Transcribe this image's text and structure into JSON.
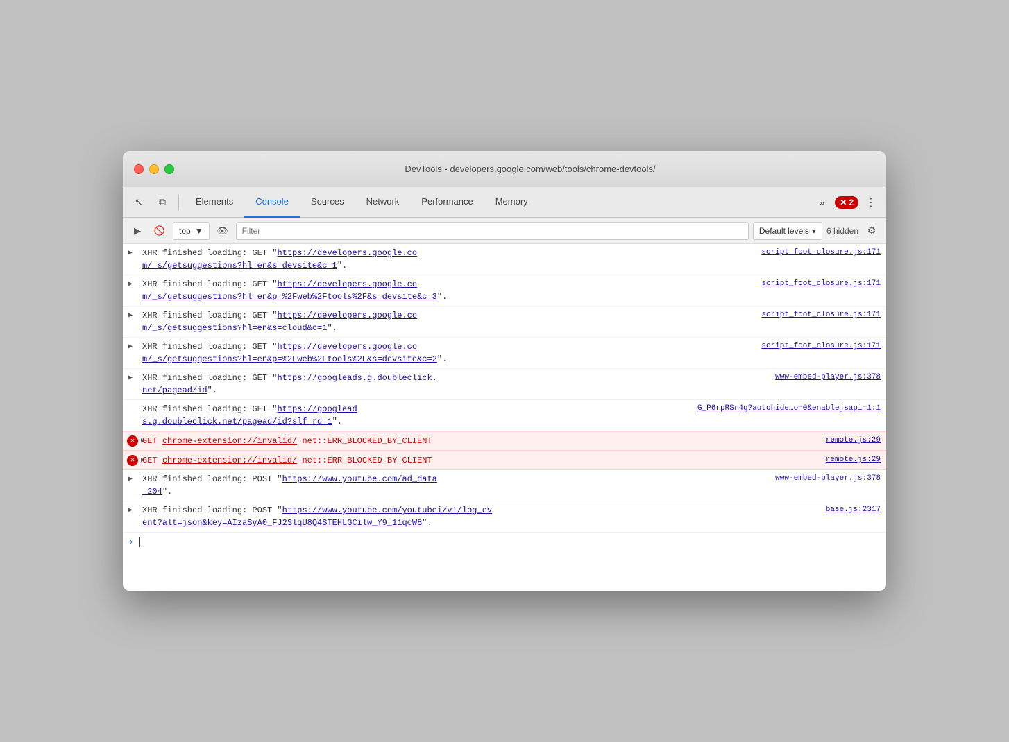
{
  "window": {
    "title": "DevTools - developers.google.com/web/tools/chrome-devtools/",
    "trafficLights": {
      "close": "close",
      "minimize": "minimize",
      "maximize": "maximize"
    }
  },
  "toolbar": {
    "inspectLabel": "↖",
    "deviceLabel": "⧉",
    "tabs": [
      {
        "id": "elements",
        "label": "Elements",
        "active": false
      },
      {
        "id": "console",
        "label": "Console",
        "active": true
      },
      {
        "id": "sources",
        "label": "Sources",
        "active": false
      },
      {
        "id": "network",
        "label": "Network",
        "active": false
      },
      {
        "id": "performance",
        "label": "Performance",
        "active": false
      },
      {
        "id": "memory",
        "label": "Memory",
        "active": false
      }
    ],
    "moreLabel": "»",
    "errorCount": "2",
    "menuLabel": "⋮"
  },
  "consoleToolbar": {
    "runLabel": "▶",
    "clearLabel": "🚫",
    "contextValue": "top",
    "contextArrow": "▼",
    "eyeLabel": "👁",
    "filterPlaceholder": "Filter",
    "levelsLabel": "Default levels",
    "levelsArrow": "▾",
    "hiddenCount": "6 hidden",
    "settingsLabel": "⚙"
  },
  "consoleEntries": [
    {
      "id": 1,
      "type": "xhr",
      "hasArrow": true,
      "content": "XHR finished loading: GET \"https://developers.google.co m/_s/getsuggestions?hl=en&s=devsite&c=1\".",
      "contentLink": "https://developers.google.co m/_s/getsuggestions?hl=en&s=devsite&c=1",
      "source": "script_foot_closure.js:171",
      "isError": false
    },
    {
      "id": 2,
      "type": "xhr",
      "hasArrow": true,
      "content": "XHR finished loading: GET \"https://developers.google.co m/_s/getsuggestions?hl=en&p=%2Fweb%2Ftools%2F&s=devsite&c=3\".",
      "contentLink": "https://developers.google.co m/_s/getsuggestions?hl=en&p=%2Fweb%2Ftools%2F&s=devsite&c=3",
      "source": "script_foot_closure.js:171",
      "isError": false
    },
    {
      "id": 3,
      "type": "xhr",
      "hasArrow": true,
      "content": "XHR finished loading: GET \"https://developers.google.co m/_s/getsuggestions?hl=en&s=cloud&c=1\".",
      "contentLink": "https://developers.google.co m/_s/getsuggestions?hl=en&s=cloud&c=1",
      "source": "script_foot_closure.js:171",
      "isError": false
    },
    {
      "id": 4,
      "type": "xhr",
      "hasArrow": true,
      "content": "XHR finished loading: GET \"https://developers.google.co m/_s/getsuggestions?hl=en&p=%2Fweb%2Ftools%2F&s=devsite&c=2\".",
      "contentLink": "https://developers.google.co m/_s/getsuggestions?hl=en&p=%2Fweb%2Ftools%2F&s=devsite&c=2",
      "source": "script_foot_closure.js:171",
      "isError": false
    },
    {
      "id": 5,
      "type": "xhr",
      "hasArrow": true,
      "content": "XHR finished loading: GET \"https://googleads.g.doubleclick. net/pagead/id\".",
      "contentLink": "https://googleads.g.doubleclick. net/pagead/id",
      "source": "www-embed-player.js:378",
      "isError": false
    },
    {
      "id": 6,
      "type": "xhr",
      "hasArrow": false,
      "content": "XHR finished loading: GET \"https://googlead s.g.doubleclick.net/pagead/id?slf_rd=1\".",
      "contentLink": "https://googlead s.g.doubleclick.net/pagead/id?slf_rd=1",
      "source": "G_P6rpRSr4g?autohide…o=0&enablejsapi=1:1",
      "isError": false
    },
    {
      "id": 7,
      "type": "get-error",
      "hasArrow": true,
      "content": "GET chrome-extension://invalid/",
      "errorText": "net::ERR_BLOCKED_BY_CLIENT",
      "contentLink": "chrome-extension://invalid/",
      "source": "remote.js:29",
      "isError": true
    },
    {
      "id": 8,
      "type": "get-error",
      "hasArrow": true,
      "content": "GET chrome-extension://invalid/",
      "errorText": "net::ERR_BLOCKED_BY_CLIENT",
      "contentLink": "chrome-extension://invalid/",
      "source": "remote.js:29",
      "isError": true
    },
    {
      "id": 9,
      "type": "xhr",
      "hasArrow": true,
      "content": "XHR finished loading: POST \"https://www.youtube.com/ad_data _204\".",
      "contentLink": "https://www.youtube.com/ad_data _204",
      "source": "www-embed-player.js:378",
      "isError": false
    },
    {
      "id": 10,
      "type": "xhr",
      "hasArrow": true,
      "content": "XHR finished loading: POST \"https://www.youtube.com/youtubei/v1/log_ev ent?alt=json&key=AIzaSyA0_FJ2SlqU8Q4STEHLGCilw_Y9_11qcW8\".",
      "contentLink": "https://www.youtube.com/youtubei/v1/log_ev ent?alt=json&key=AIzaSyA0_FJ2SlqU8Q4STEHLGCilw_Y9_11qcW8",
      "source": "base.js:2317",
      "isError": false
    }
  ]
}
